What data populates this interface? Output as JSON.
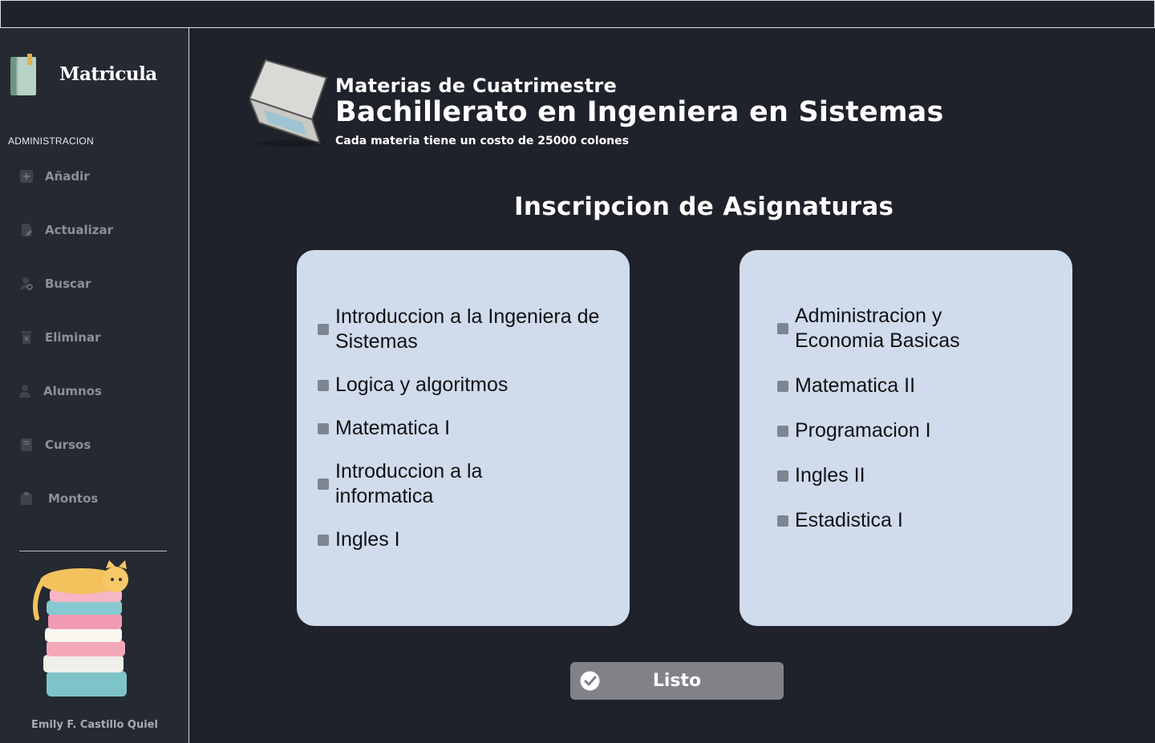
{
  "app": {
    "brand": "Matricula"
  },
  "sidebar": {
    "section_label": "ADMINISTRACION",
    "items": [
      {
        "label": "Añadir",
        "icon": "plus-square-icon"
      },
      {
        "label": "Actualizar",
        "icon": "file-edit-icon"
      },
      {
        "label": "Buscar",
        "icon": "user-search-icon"
      },
      {
        "label": "Eliminar",
        "icon": "trash-icon"
      },
      {
        "label": "Alumnos",
        "icon": "user-icon"
      },
      {
        "label": "Cursos",
        "icon": "book-icon"
      },
      {
        "label": "Montos",
        "icon": "clipboard-icon"
      }
    ],
    "author": "Emily F. Castillo Quiel"
  },
  "header": {
    "subtitle": "Materias de Cuatrimestre",
    "title": "Bachillerato en Ingeniera en Sistemas",
    "note": "Cada materia tiene un costo de 25000 colones"
  },
  "main": {
    "section_title": "Inscripcion de Asignaturas",
    "left_courses": [
      "Introduccion a la Ingeniera de Sistemas",
      "Logica y algoritmos",
      "Matematica I",
      "Introduccion a la informatica",
      "Ingles I"
    ],
    "right_courses": [
      "Administracion y Economia Basicas",
      "Matematica II",
      "Programacion I",
      "Ingles II",
      "Estadistica I"
    ],
    "button_label": "Listo"
  },
  "colors": {
    "background": "#1f222a",
    "sidebar": "#252932",
    "card": "#d0dbec",
    "button": "#808288",
    "nav_text": "#8b909a"
  }
}
